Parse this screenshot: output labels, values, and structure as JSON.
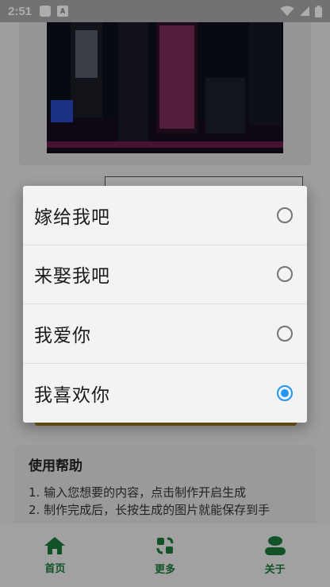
{
  "status_bar": {
    "time": "2:51",
    "notification_icon_letter": "A"
  },
  "dialog": {
    "options": [
      {
        "label": "嫁给我吧",
        "selected": false
      },
      {
        "label": "来娶我吧",
        "selected": false
      },
      {
        "label": "我爱你",
        "selected": false
      },
      {
        "label": "我喜欢你",
        "selected": true
      }
    ]
  },
  "help": {
    "title": "使用帮助",
    "lines": [
      "1. 输入您想要的内容，点击制作开启生成",
      "2. 制作完成后，长按生成的图片就能保存到手"
    ]
  },
  "nav": {
    "items": [
      {
        "label": "首页",
        "icon": "home-icon"
      },
      {
        "label": "更多",
        "icon": "refresh-icon"
      },
      {
        "label": "关于",
        "icon": "person-icon"
      }
    ]
  },
  "colors": {
    "accent_green": "#1b7a3a",
    "radio_selected": "#2196f3"
  }
}
